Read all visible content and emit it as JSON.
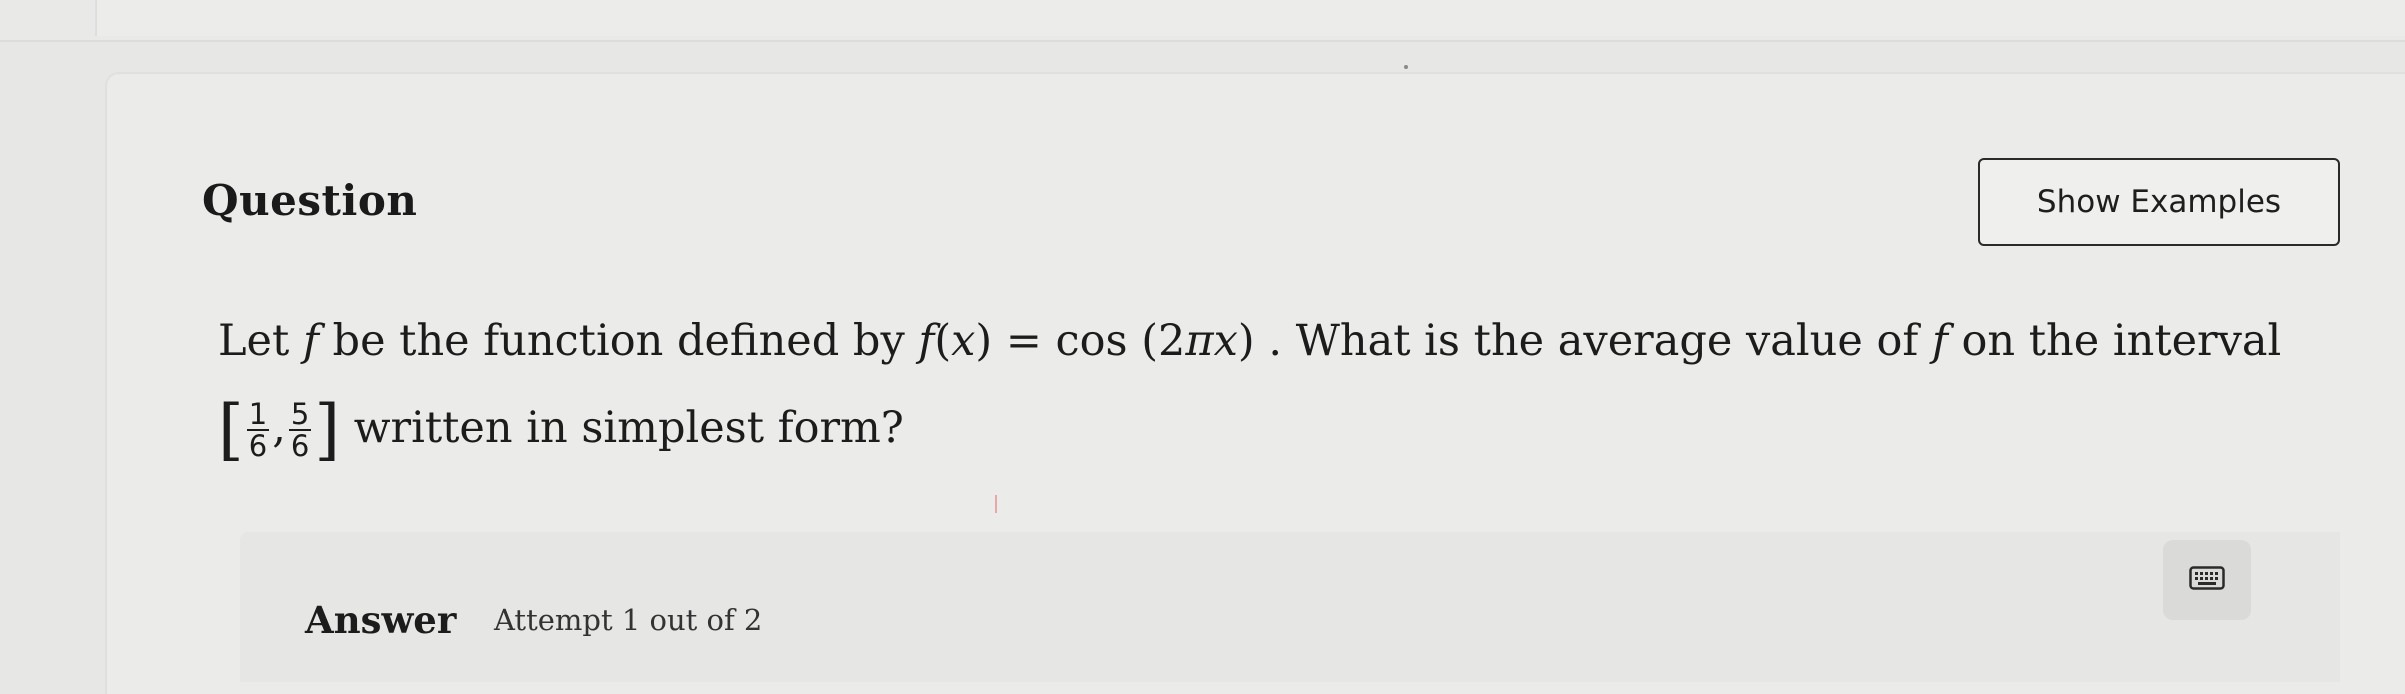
{
  "question": {
    "heading": "Question",
    "show_examples_label": "Show Examples",
    "line1": {
      "let": "Let ",
      "f1": "f",
      "be_defined": " be the function defined by ",
      "fx_f": "f",
      "fx_open": "(",
      "fx_x": "x",
      "fx_close": ")",
      "equals": " = cos (2",
      "pi": "π",
      "x": "x",
      "close": ")",
      "what": " . What is the average value of ",
      "f2": "f",
      "on_interval": " on the interval"
    },
    "line2": {
      "left_bracket": "[",
      "frac1_num": "1",
      "frac1_den": "6",
      "comma": ",",
      "frac2_num": "5",
      "frac2_den": "6",
      "right_bracket": "]",
      "rest": " written in simplest form?"
    }
  },
  "answer": {
    "label": "Answer",
    "attempt": "Attempt 1 out of 2",
    "keyboard_icon": "keyboard-icon"
  }
}
